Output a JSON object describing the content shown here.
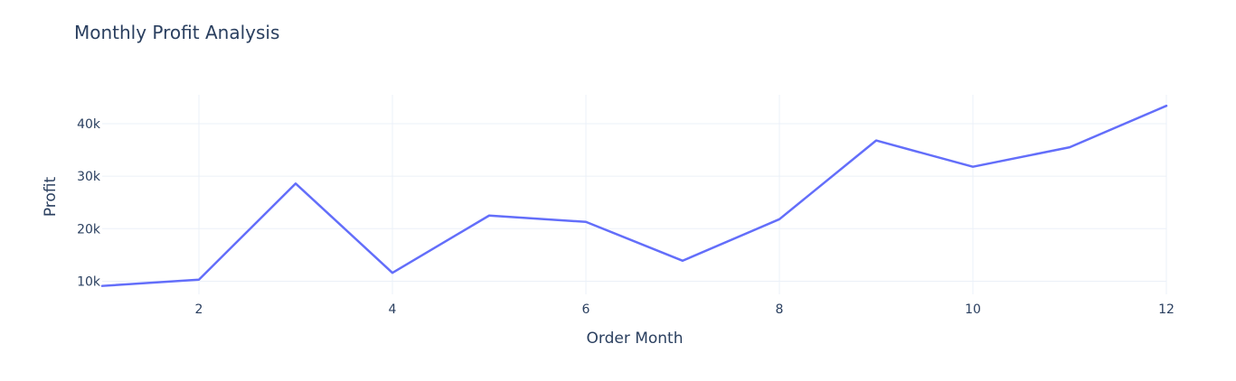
{
  "chart_data": {
    "type": "line",
    "title": "Monthly Profit Analysis",
    "xlabel": "Order Month",
    "ylabel": "Profit",
    "x": [
      1,
      2,
      3,
      4,
      5,
      6,
      7,
      8,
      9,
      10,
      11,
      12
    ],
    "series": [
      {
        "values": [
          9100,
          10300,
          28600,
          11600,
          22500,
          21300,
          13900,
          21800,
          36800,
          31800,
          35500,
          43400
        ]
      }
    ],
    "xlim": [
      1,
      12
    ],
    "ylim": [
      7500,
      45500
    ],
    "x_ticks": [
      2,
      4,
      6,
      8,
      10,
      12
    ],
    "x_tick_labels": [
      "2",
      "4",
      "6",
      "8",
      "10",
      "12"
    ],
    "y_ticks": [
      10000,
      20000,
      30000,
      40000
    ],
    "y_tick_labels": [
      "10k",
      "20k",
      "30k",
      "40k"
    ],
    "grid": true,
    "legend": false,
    "line_color": "#636efa"
  }
}
